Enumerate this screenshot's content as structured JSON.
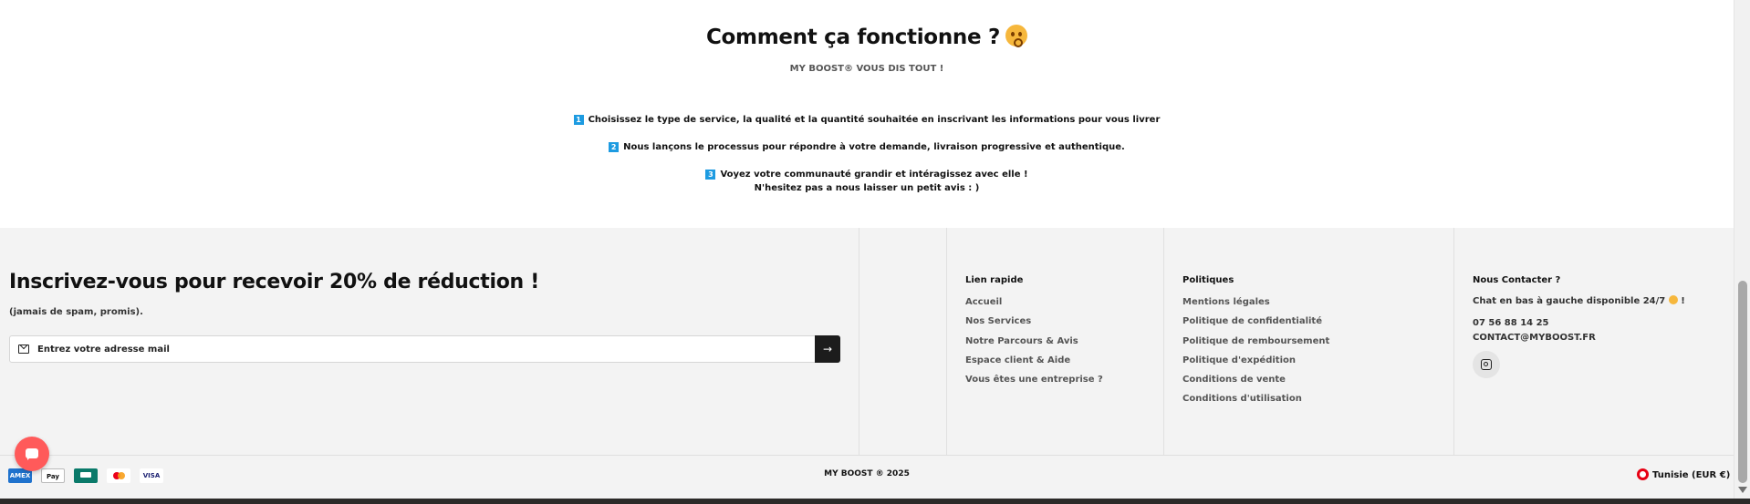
{
  "how": {
    "title": "Comment ça fonctionne ?",
    "emoji_icon": "flushed-face-emoji-icon",
    "subtitle": "MY BOOST® VOUS DIS TOUT !",
    "steps": [
      {
        "number": "1",
        "text": "Choisissez le type de service, la qualité et la quantité souhaitée en inscrivant les informations pour vous livrer"
      },
      {
        "number": "2",
        "text": "Nous lançons le processus pour répondre à votre demande, livraison progressive et authentique."
      },
      {
        "number": "3",
        "text": "Voyez votre communauté grandir et intéragissez avec elle !",
        "extra": "N'hesitez pas a nous laisser un petit avis : )"
      }
    ]
  },
  "newsletter": {
    "title": "Inscrivez-vous pour recevoir 20% de réduction !",
    "subtitle": "(jamais de spam, promis).",
    "input_placeholder": "Entrez votre adresse mail",
    "submit_icon": "arrow-right-icon"
  },
  "quick_links": {
    "title": "Lien rapide",
    "items": [
      "Accueil",
      "Nos Services",
      "Notre Parcours & Avis",
      "Espace client & Aide",
      "Vous êtes une entreprise ?"
    ]
  },
  "policies": {
    "title": "Politiques",
    "items": [
      "Mentions légales",
      "Politique de confidentialité",
      "Politique de remboursement",
      "Politique d'expédition",
      "Conditions de vente",
      "Conditions d'utilisation"
    ]
  },
  "contact": {
    "title": "Nous Contacter ?",
    "chat_note": "Chat en bas à gauche disponible 24/7",
    "chat_note_end": "!",
    "phone": "07 56 88 14 25",
    "email": "CONTACT@MYBOOST.FR",
    "social_icon": "instagram-icon"
  },
  "bottom": {
    "payments": [
      "AMEX",
      "Pay",
      "",
      "",
      "VISA"
    ],
    "copyright": "MY BOOST ® 2025",
    "country": "Tunisie (EUR €)"
  },
  "colors": {
    "step_badge": "#1d9be1",
    "chat_button": "#ff5a5a",
    "footer_bg": "#f3f3f3"
  }
}
